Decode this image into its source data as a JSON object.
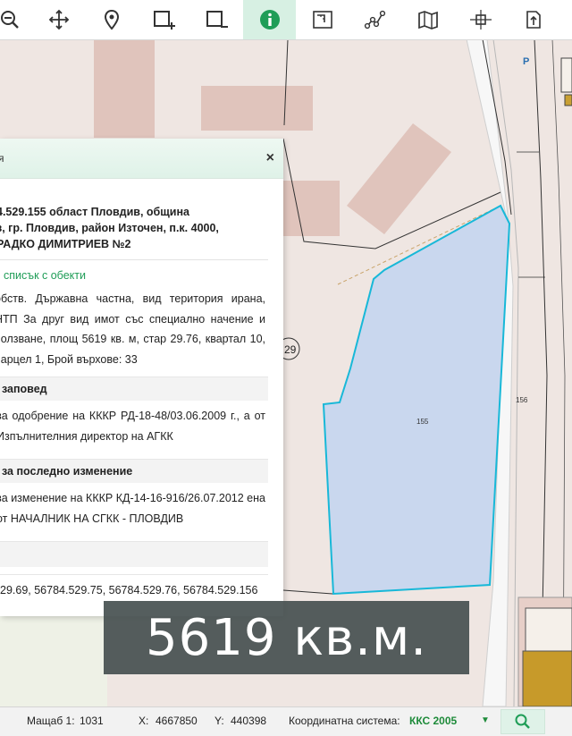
{
  "toolbar": {
    "tools": [
      {
        "icon": "zoom-out-icon"
      },
      {
        "icon": "pan-arrows-icon"
      },
      {
        "icon": "location-pin-icon"
      },
      {
        "icon": "select-add-icon"
      },
      {
        "icon": "select-remove-icon"
      },
      {
        "icon": "info-icon",
        "active": true
      },
      {
        "icon": "measure-icon"
      },
      {
        "icon": "polyline-icon"
      },
      {
        "icon": "map-book-icon"
      },
      {
        "icon": "crosshair-icon"
      },
      {
        "icon": "export-icon"
      }
    ],
    "active_color": "#1f9d57"
  },
  "map": {
    "labels": {
      "parcel_155": "155",
      "parcel_156": "156",
      "parcel_129": "29",
      "parking": "P"
    },
    "colors": {
      "background": "#efe6e2",
      "building": "#e0c4bc",
      "selected_fill": "#c6d6ee",
      "selected_stroke": "#18b8d8",
      "road": "#f7f7f7"
    }
  },
  "panel": {
    "title_fragment": "я",
    "close_label": "×",
    "address_line1": "4.529.155 област Пловдив, община",
    "address_line2": "з, гр. Пловдив, район Източен, п.к. 4000,",
    "address_line3": "РАДКО ДИМИТРИЕВ №2",
    "objects_link": "списък с обекти",
    "description": "обств. Държавна частна, вид територия ирана, НТП За друг вид имот със специално начение и ползване, площ 5619 кв. м, стар 29.76, квартал 10, парцел 1, Брой върхове: 33",
    "order_heading": "заповед",
    "order_text": "за одобрение на КККР РД-18-48/03.06.2009 г., а от Изпълнителния директор на АГКК",
    "change_heading": "за последно изменение",
    "change_text": "за изменение на КККР КД-14-16-916/26.07.2012 ена от НАЧАЛНИК НА СГКК - ПЛОВДИВ",
    "neighbors": "29.69, 56784.529.75, 56784.529.76, 56784.529.156"
  },
  "area_badge": "5619 кв.м.",
  "statusbar": {
    "scale_label": "Мащаб 1:",
    "scale_value": "1031",
    "x_label": "X:",
    "x_value": "4667850",
    "y_label": "Y:",
    "y_value": "440398",
    "crs_label": "Координатна система:",
    "crs_value": "ККС 2005"
  }
}
